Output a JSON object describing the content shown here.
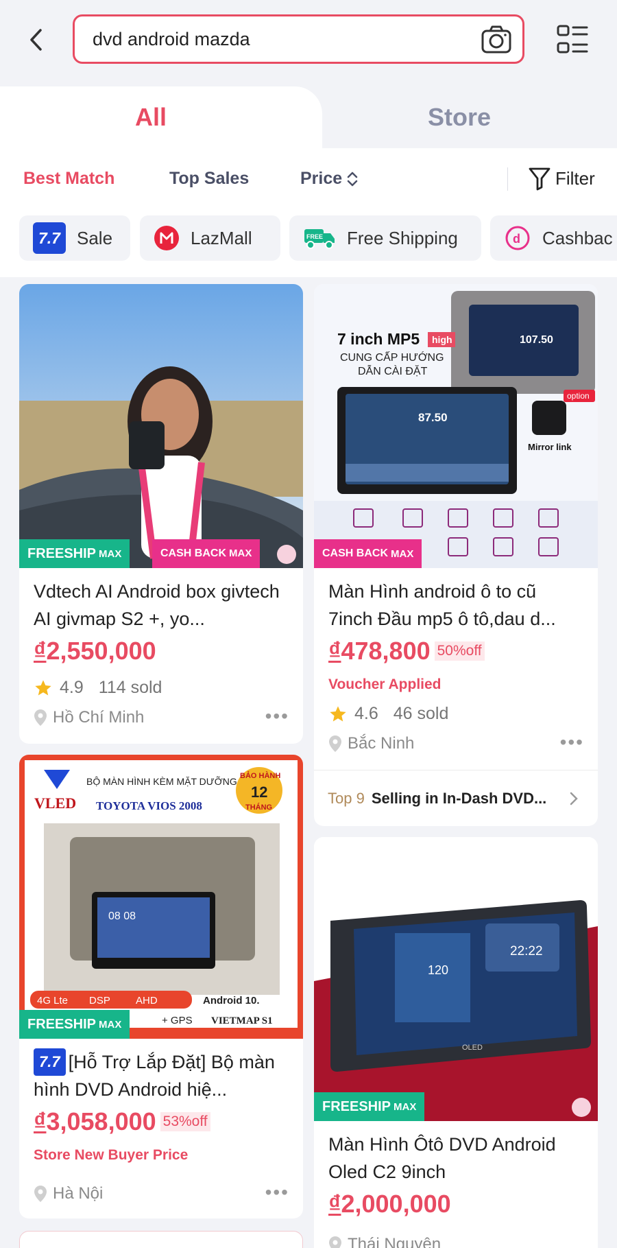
{
  "header": {
    "search_value": "dvd android mazda"
  },
  "tabs": [
    {
      "label": "All"
    },
    {
      "label": "Store"
    }
  ],
  "sort": {
    "best_match": "Best Match",
    "top_sales": "Top Sales",
    "price": "Price",
    "filter": "Filter"
  },
  "chips": [
    {
      "label": "Sale",
      "icon": "7.7"
    },
    {
      "label": "LazMall",
      "icon": "lazmall-icon"
    },
    {
      "label": "Free Shipping",
      "icon": "free-truck-icon"
    },
    {
      "label": "Cashbac",
      "icon": "cashback-icon"
    }
  ],
  "badges": {
    "freeship": "FREESHIP",
    "max": "MAX",
    "cashback": "CASH BACK",
    "top_tag": "7.7"
  },
  "products": [
    {
      "title": "Vdtech AI Android box givtech AI givmap S2 +, yo...",
      "currency": "₫",
      "price": "2,550,000",
      "rating": "4.9",
      "sold": "114 sold",
      "location": "Hồ Chí Minh"
    },
    {
      "title": "Màn Hình android ô to cũ 7inch Đầu mp5 ô tô,dau d...",
      "currency": "₫",
      "price": "478,800",
      "discount": "50%off",
      "voucher": "Voucher Applied",
      "rating": "4.6",
      "sold": "46 sold",
      "location": "Bắc Ninh",
      "rank_num": "Top 9",
      "rank_text": "Selling in In-Dash DVD...",
      "image_text": {
        "headline": "7 inch MP5",
        "high": "high",
        "line1": "CUNG CẤP HƯỚNG",
        "line2": "DẪN CÀI ĐẶT",
        "freq": "87.50",
        "option": "option",
        "mirror": "Mirror link"
      }
    },
    {
      "title": "[Hỗ Trợ Lắp Đặt] Bộ màn hình DVD Android hiệ...",
      "currency": "₫",
      "price": "3,058,000",
      "discount": "53%off",
      "voucher": "Store New Buyer Price",
      "location": "Hà Nội",
      "image_text": {
        "brand": "VLED",
        "top": "BỘ MÀN HÌNH KÈM MẶT DƯỠNG",
        "model": "TOYOTA VIOS 2008",
        "warranty_num": "12",
        "warranty": "BẢO HÀNH",
        "month": "THÁNG",
        "f1": "4G Lte",
        "f2": "DSP",
        "f3": "AHD",
        "f4": "Android 10.",
        "f5": "+ GPS",
        "f6": "VIETMAP S1"
      }
    },
    {
      "title": "Màn Hình Ôtô DVD Android Oled C2 9inch",
      "currency": "₫",
      "price": "2,000,000",
      "location": "Thái Nguyên",
      "image_text": {
        "speed": "120",
        "time": "22:22",
        "oled": "OLED"
      }
    }
  ],
  "colors": {
    "accent": "#e84b62",
    "freeship": "#17b58a",
    "cashback": "#e8308a",
    "lazmall": "#e8243c",
    "sale_blue": "#1f49d6"
  }
}
